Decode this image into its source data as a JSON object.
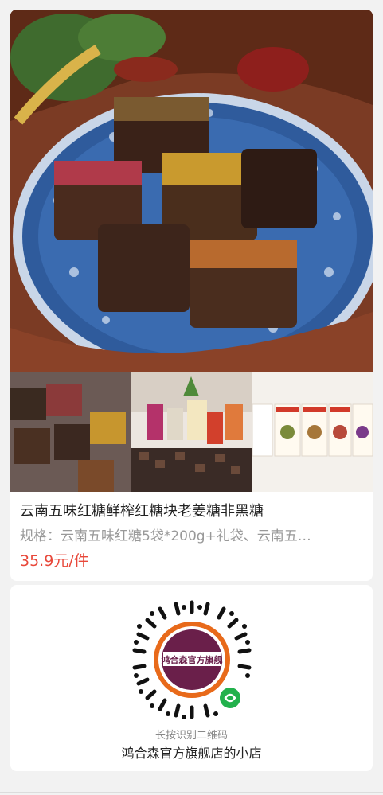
{
  "product": {
    "title": "云南五味红糖鲜榨红糖块老姜糖非黑糖",
    "spec": "规格：云南五味红糖5袋*200g+礼袋、云南五…",
    "price": "35.9元/件",
    "images": {
      "main": "brown-sugar-cubes-on-blue-plate",
      "thumbnails": [
        "sugar-cubes-on-cloth",
        "gift-packages-on-table",
        "product-boxes-row"
      ]
    }
  },
  "shop": {
    "qr_logo_text": "鸿合森官方旗舰",
    "qr_hint": "长按识别二维码",
    "name": "鸿合森官方旗舰店的小店",
    "mini_program_icon": "mini-program-icon"
  },
  "colors": {
    "background": "#f2f2f2",
    "card": "#ffffff",
    "price": "#e8483a",
    "muted_text": "#999999",
    "mini_program_green": "#22b14c"
  }
}
